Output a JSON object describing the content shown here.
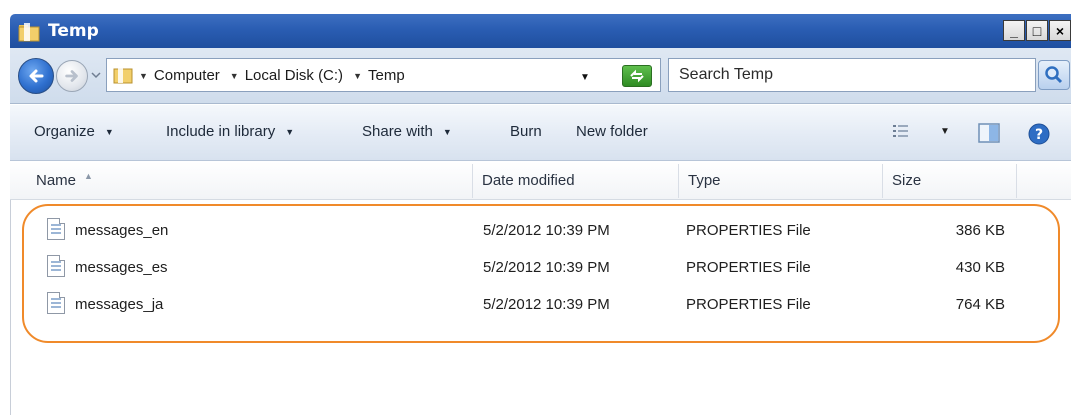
{
  "window": {
    "title": "Temp",
    "controls": [
      "minimize-icon",
      "maximize-icon",
      "close-icon"
    ]
  },
  "nav": {
    "breadcrumb": [
      "Computer",
      "Local Disk (C:)",
      "Temp"
    ],
    "search_placeholder": "Search Temp"
  },
  "toolbar": {
    "organize": "Organize",
    "include_in_library": "Include in library",
    "share_with": "Share with",
    "burn": "Burn",
    "new_folder": "New folder"
  },
  "columns": {
    "name": "Name",
    "date_modified": "Date modified",
    "type": "Type",
    "size": "Size"
  },
  "files": [
    {
      "name": "messages_en",
      "date": "5/2/2012 10:39 PM",
      "type": "PROPERTIES File",
      "size": "386 KB"
    },
    {
      "name": "messages_es",
      "date": "5/2/2012 10:39 PM",
      "type": "PROPERTIES File",
      "size": "430 KB"
    },
    {
      "name": "messages_ja",
      "date": "5/2/2012 10:39 PM",
      "type": "PROPERTIES File",
      "size": "764 KB"
    }
  ],
  "colors": {
    "titlebar": "#2a5db2",
    "highlight": "#f08a2a"
  }
}
